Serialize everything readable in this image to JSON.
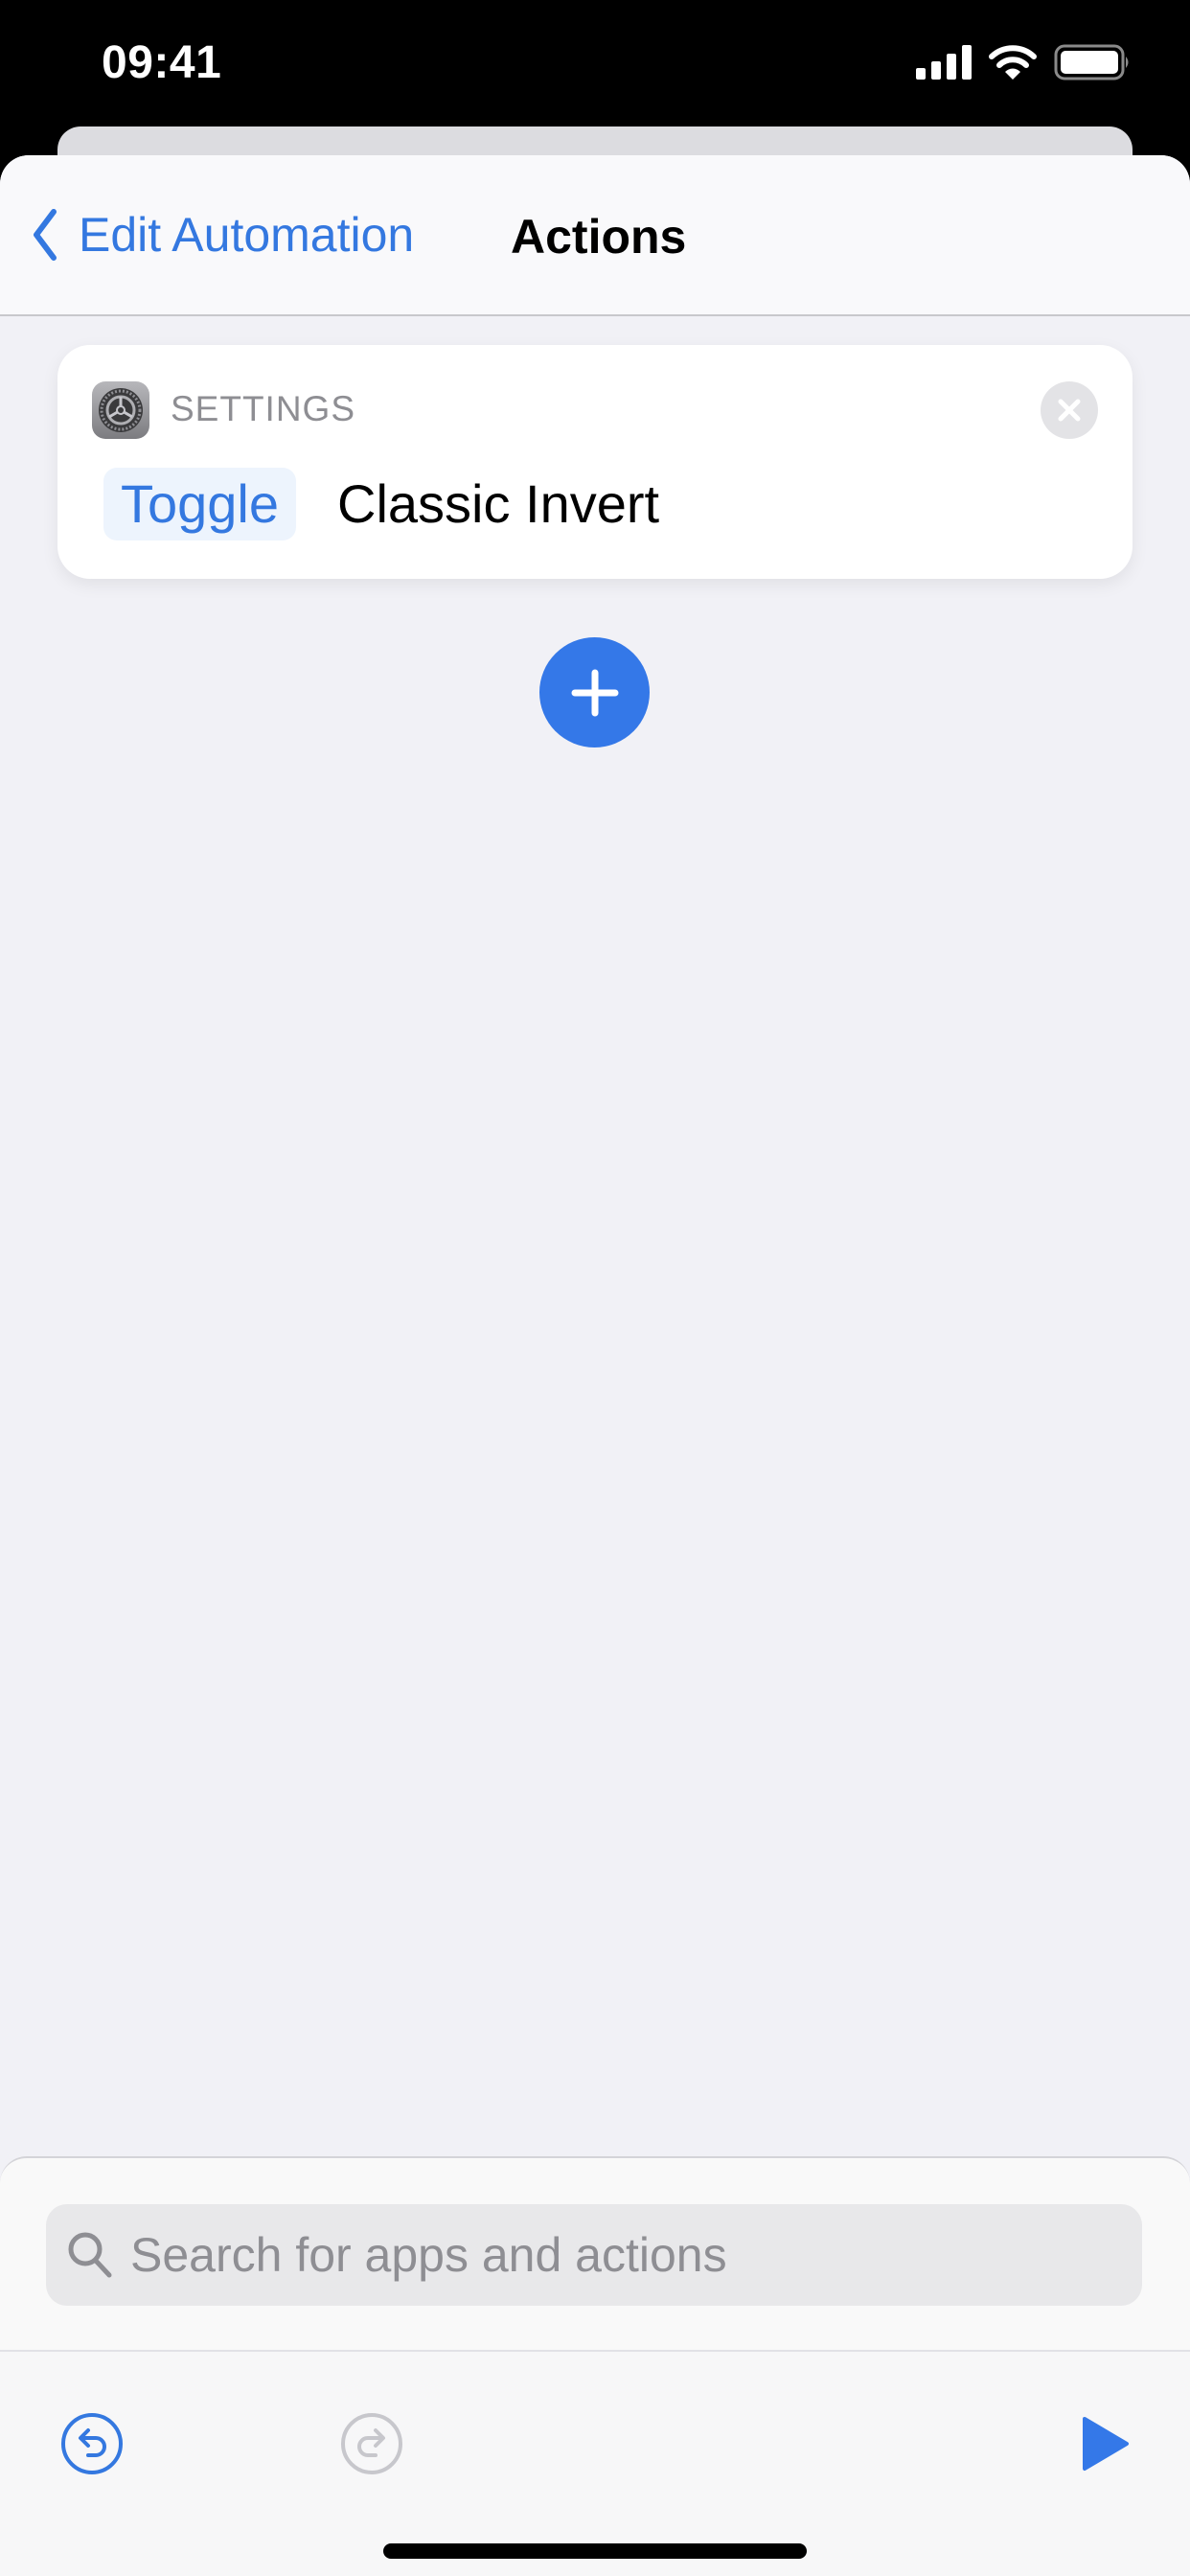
{
  "status_bar": {
    "time": "09:41",
    "icons": [
      "cellular-signal-icon",
      "wifi-icon",
      "battery-icon"
    ]
  },
  "nav": {
    "back_label": "Edit Automation",
    "back_icon": "chevron-left-icon",
    "title": "Actions"
  },
  "action_card": {
    "app_icon": "settings-gear-icon",
    "app_label": "SETTINGS",
    "verb": "Toggle",
    "subject": "Classic Invert",
    "close_icon": "close-icon"
  },
  "add_button": {
    "icon": "plus-icon"
  },
  "search": {
    "placeholder": "Search for apps and actions",
    "value": ""
  },
  "toolbar": {
    "undo_icon": "undo-icon",
    "redo_icon": "redo-icon",
    "run_icon": "play-icon"
  },
  "colors": {
    "accent": "#3478e0",
    "background": "#f1f1f6",
    "card": "#ffffff",
    "secondary_text": "#8e8e93",
    "disabled": "#c7c7cc"
  }
}
